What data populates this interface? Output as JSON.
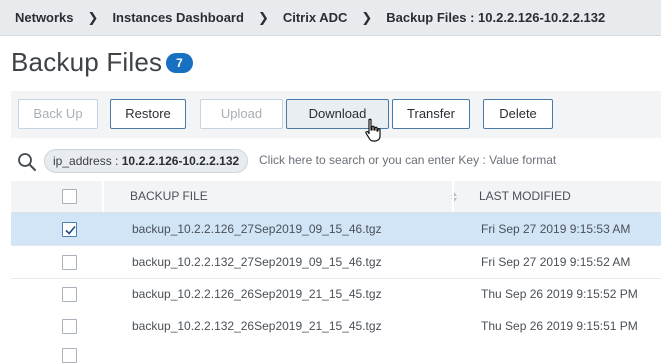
{
  "breadcrumb": [
    "Networks",
    "Instances Dashboard",
    "Citrix ADC",
    "Backup Files : 10.2.2.126-10.2.2.132"
  ],
  "page": {
    "title": "Backup Files",
    "count": "7"
  },
  "toolbar": {
    "back_up": "Back Up",
    "restore": "Restore",
    "upload": "Upload",
    "download": "Download",
    "transfer": "Transfer",
    "delete": "Delete"
  },
  "search": {
    "chip_key": "ip_address",
    "chip_sep": " : ",
    "chip_value": "10.2.2.126-10.2.2.132",
    "hint": "Click here to search or you can enter Key : Value format"
  },
  "table": {
    "columns": [
      "BACKUP FILE",
      "LAST MODIFIED"
    ],
    "rows": [
      {
        "file": "backup_10.2.2.126_27Sep2019_09_15_46.tgz",
        "modified": "Fri Sep 27 2019 9:15:53 AM",
        "selected": true
      },
      {
        "file": "backup_10.2.2.132_27Sep2019_09_15_46.tgz",
        "modified": "Fri Sep 27 2019 9:15:52 AM",
        "selected": false
      },
      {
        "file": "backup_10.2.2.126_26Sep2019_21_15_45.tgz",
        "modified": "Thu Sep 26 2019 9:15:52 PM",
        "selected": false
      },
      {
        "file": "backup_10.2.2.132_26Sep2019_21_15_45.tgz",
        "modified": "Thu Sep 26 2019 9:15:51 PM",
        "selected": false
      }
    ]
  },
  "colors": {
    "accent": "#1870c2",
    "selected_row": "#d2e5f6",
    "button_border": "#4a79a8"
  },
  "icons": [
    "chevron-right-icon",
    "search-icon",
    "sort-icon",
    "checkmark-icon",
    "hand-cursor-icon"
  ]
}
